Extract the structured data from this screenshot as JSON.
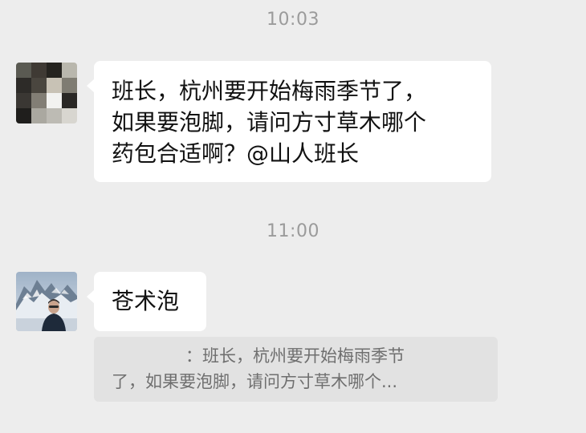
{
  "chat": {
    "timestamps": [
      "10:03",
      "11:00"
    ],
    "messages": [
      {
        "sender": "other",
        "avatar": "pixelated-avatar-icon",
        "lines": [
          "班长，杭州要开始梅雨季节了，",
          "如果要泡脚，请问方寸草木哪个",
          "药包合适啊？@山人班长"
        ]
      },
      {
        "sender": "other",
        "avatar": "mountain-portrait-avatar-icon",
        "text": "苍术泡",
        "quote": {
          "line1": "：班长，杭州要开始梅雨季节",
          "line2": "了，如果要泡脚，请问方寸草木哪个..."
        }
      }
    ]
  },
  "colors": {
    "background": "#ededed",
    "bubble": "#ffffff",
    "quote_bg": "#e2e2e2",
    "timestamp": "#9b9b9b"
  }
}
